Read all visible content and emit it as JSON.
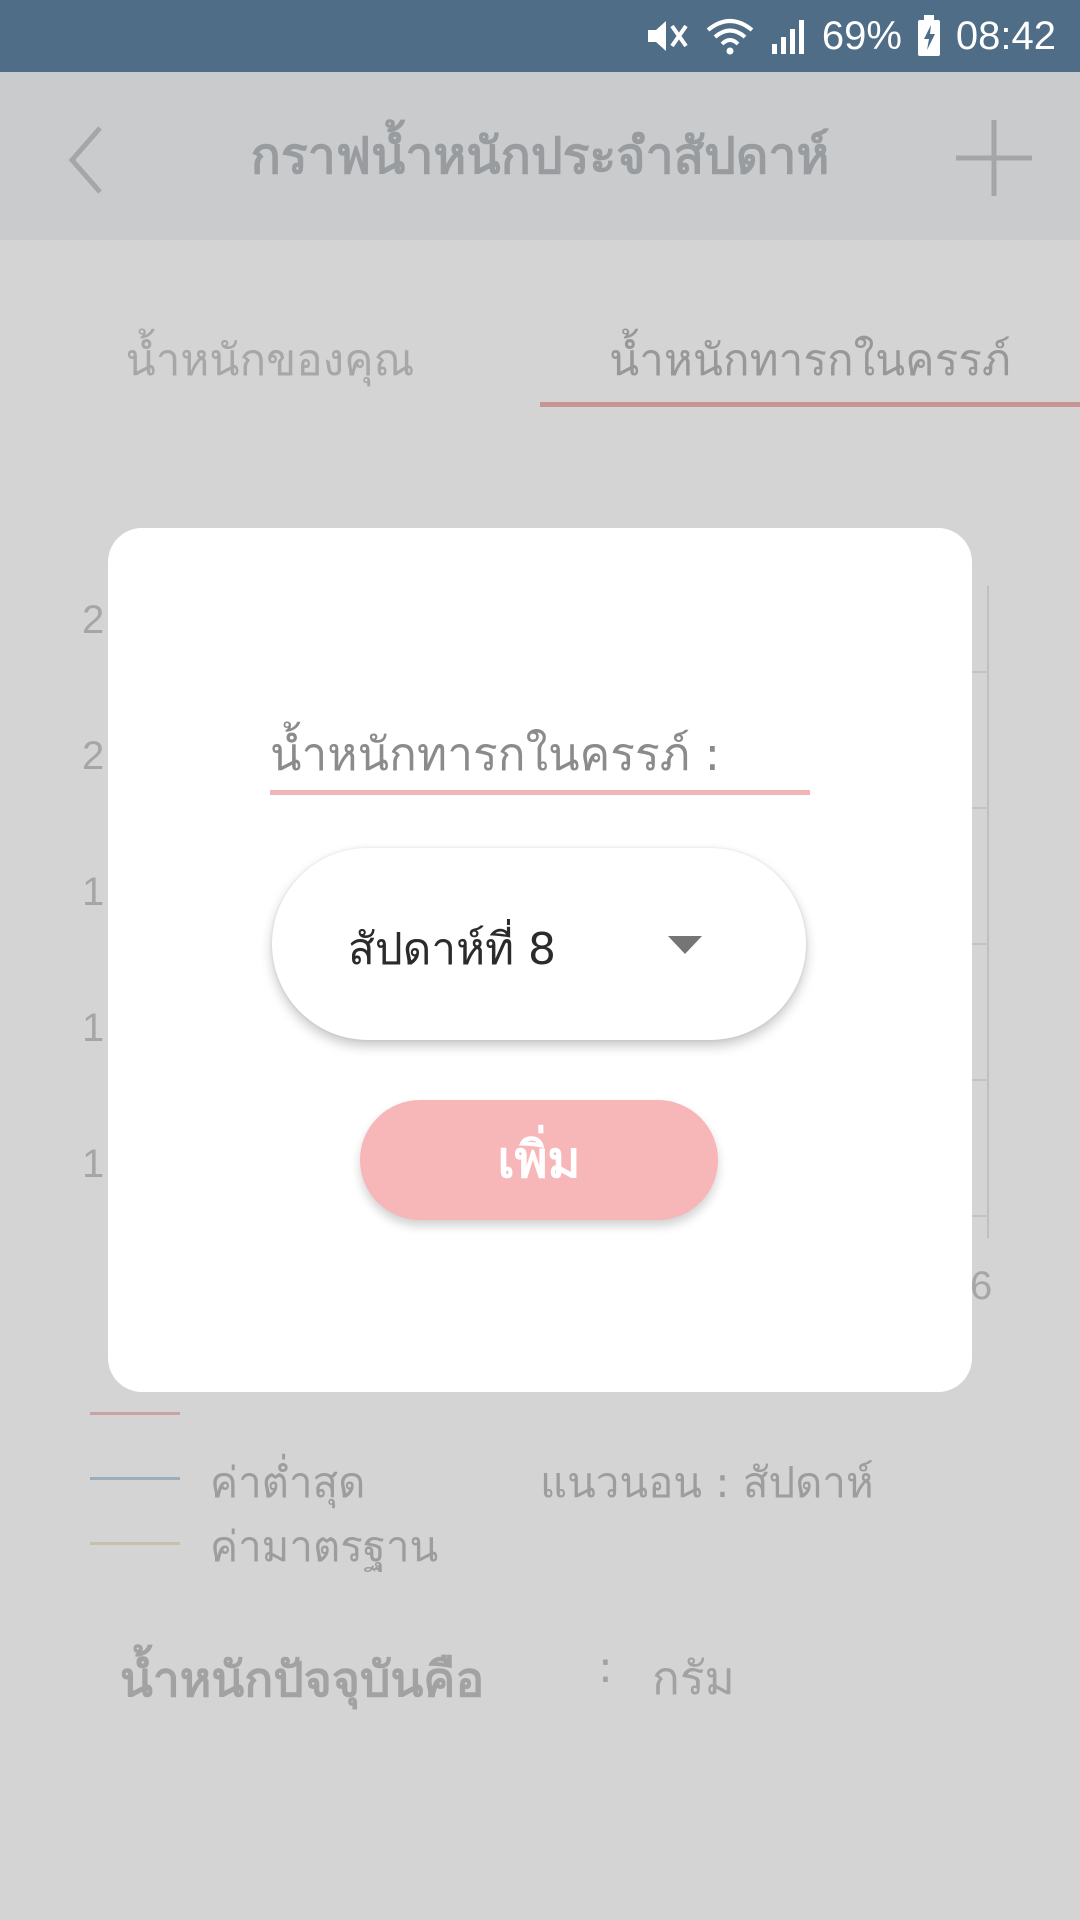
{
  "status_bar": {
    "battery_percent": "69%",
    "time": "08:42",
    "icons": [
      "mute-vibrate-icon",
      "wifi-icon",
      "signal-icon",
      "battery-charging-icon"
    ]
  },
  "app": {
    "header": {
      "title": "กราฟน้ำหนักประจำสัปดาห์",
      "back_icon": "chevron-left-icon",
      "add_icon": "plus-icon"
    },
    "tabs": [
      {
        "label": "น้ำหนักของคุณ",
        "selected": false
      },
      {
        "label": "น้ำหนักทารกในครรภ์",
        "selected": true
      }
    ],
    "chart": {
      "y_ticks_visible": [
        "2",
        "2",
        "1",
        "1",
        "1"
      ],
      "x_tick_visible": "6"
    },
    "legend": [
      {
        "label": "ค่าต่ำสุด",
        "color": "#bcd0e2"
      },
      {
        "label": "ค่ามาตรฐาน",
        "color": "#eee7cf"
      }
    ],
    "legend_top_color": "#f2c4c6",
    "axis_note": "แนวนอน : สัปดาห์",
    "current_weight": {
      "label": "น้ำหนักปัจจุบันคือ",
      "separator": ":",
      "unit": "กรัม"
    }
  },
  "dialog": {
    "field_label": "น้ำหนักทารกในครรภ์ :",
    "week_select": {
      "value": "สัปดาห์ที่ 8"
    },
    "add_button_label": "เพิ่ม"
  },
  "colors": {
    "status_bar": "#4f6d86",
    "accent_pink": "#f7b6b8",
    "underline_pink": "#f3b6b6"
  }
}
